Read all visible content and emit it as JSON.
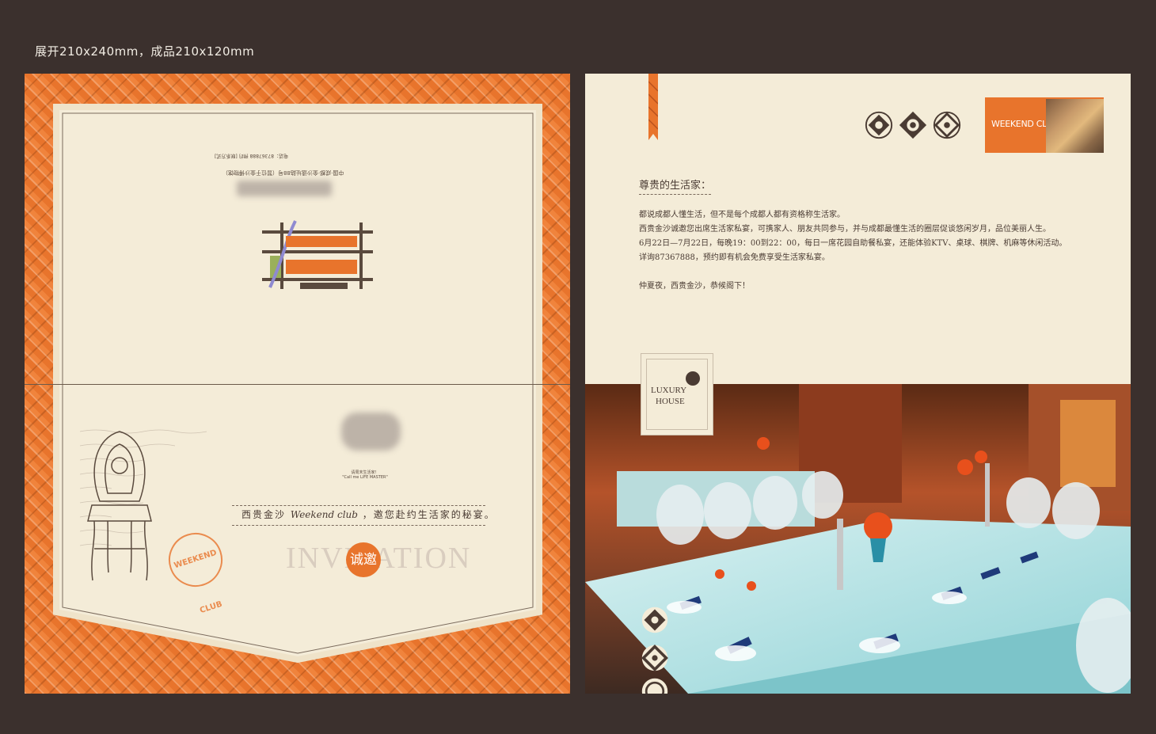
{
  "spec_text": "展开210x240mm，成品210x120mm",
  "left_panel": {
    "invite_prefix": "西贵金沙",
    "invite_script": "Weekend club",
    "invite_suffix": "，邀您赴约生活家的秘宴。",
    "invitation_word": "INVITATION",
    "invitation_badge": "诚邀",
    "stamp_text": "WEEKEND CLUB",
    "small_line_1": "请周末生活家！",
    "small_line_2": "\"Call me LIFE MASTER\"",
    "address_line": "中国·成都·金沙遗址路88号（暂位于金沙博物馆）",
    "contact_line": "电话：87367888 预约 [联系方式]"
  },
  "right_panel": {
    "weekend_label": "WEEKEND CLUB",
    "greeting": "尊贵的生活家：",
    "paragraphs": [
      "都说成都人懂生活，但不是每个成都人都有资格称生活家。",
      "西贵金沙诚邀您出席生活家私宴，可携家人、朋友共同参与，并与成都最懂生活的圈层促谈悠闲岁月，品位美丽人生。",
      "6月22日—7月22日，每晚19：00到22：00，每日一席花园自助餐私宴，还能体验KTV、桌球、棋牌、机麻等休闲活动。",
      "详询87367888，预约即有机会免费享受生活家私宴。",
      "",
      "仲夏夜，西贵金沙，恭候阁下！"
    ],
    "luxury_line_1": "LUXURY",
    "luxury_line_2": "HOUSE"
  },
  "colors": {
    "background": "#3b302d",
    "orange": "#e8742c",
    "paper": "#f4ecd8"
  }
}
